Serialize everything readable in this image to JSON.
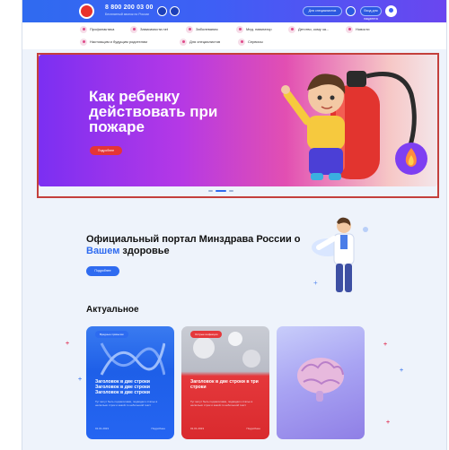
{
  "header": {
    "phone": "8 800 200 03 00",
    "phone_sub": "Бесплатный звонок по России",
    "btn_a": "Для специалистов",
    "btn_b": "Вход для пациента"
  },
  "nav": {
    "items": [
      {
        "label": "Профилактика"
      },
      {
        "label": "Зависимости.net"
      },
      {
        "label": "Заболевания"
      },
      {
        "label": "Мед. навигатор"
      },
      {
        "label": "Детство, кому за..."
      },
      {
        "label": "Новости"
      },
      {
        "label": "Настоящим и будущим родителям"
      },
      {
        "label": "Для специалистов"
      },
      {
        "label": "Сервисы"
      }
    ]
  },
  "hero": {
    "title": "Как ребенку действовать при пожаре",
    "button": "Подробнее"
  },
  "portal": {
    "title_part1": "Официальный портал Минздрава России о ",
    "title_accent": "Вашем",
    "title_part2": " здоровье",
    "button": "Подробнее"
  },
  "section": {
    "title": "Актуальное"
  },
  "cards": [
    {
      "tag": "Вредные привычки",
      "title": "Заголовок в две строки Заголовок в две строки Заголовок в две строки",
      "text": "Тут могут быть подзаголовки, подводки к статье в несколько строк и какой-то небольшой текст",
      "date": "01.01.2023",
      "more": "Подробнее"
    },
    {
      "tag": "Острые инфекции",
      "title": "Заголовок в две строки в три строки",
      "text": "Тут могут быть подзаголовки, подводки к статье в несколько строк и какой-то небольшой текст",
      "date": "01.01.2023",
      "more": "Подробнее"
    },
    {
      "tag": "",
      "title": "",
      "text": "",
      "date": "",
      "more": ""
    }
  ],
  "colors": {
    "accent": "#2f6bf0",
    "brand_red": "#e53535",
    "selection": "#c4403c"
  }
}
